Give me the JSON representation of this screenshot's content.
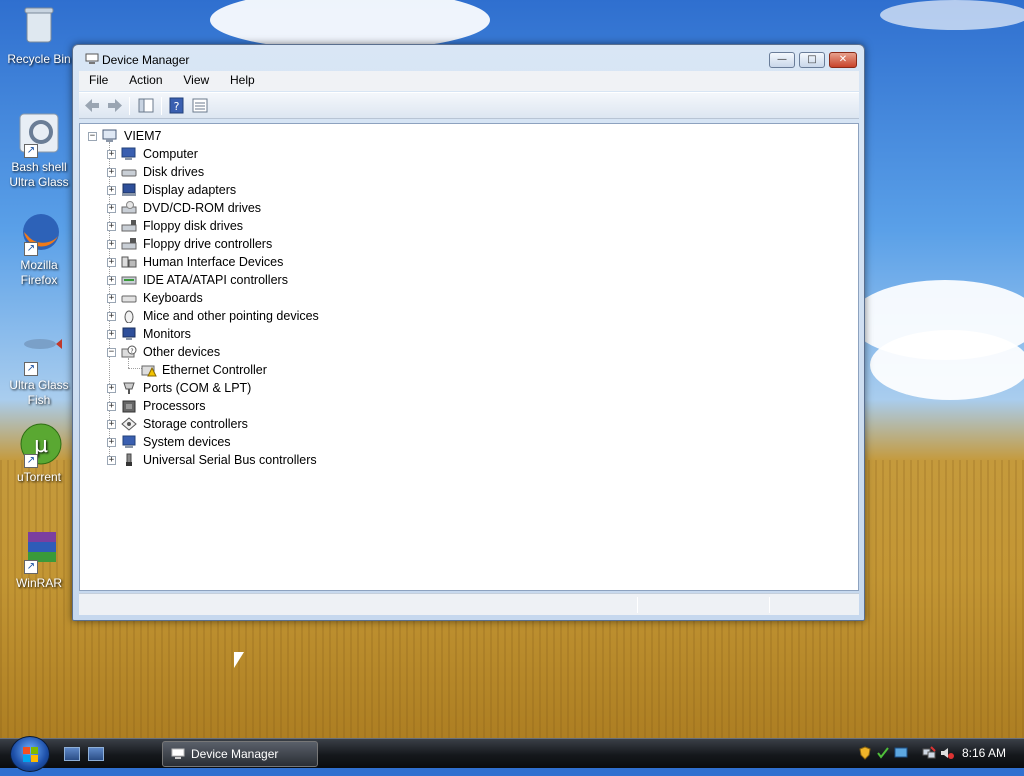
{
  "desktop": {
    "icons": [
      {
        "name": "recycle-bin",
        "label": "Recycle Bin"
      },
      {
        "name": "bash-shell",
        "label": "Bash shell Ultra Glass"
      },
      {
        "name": "mozilla-firefox",
        "label": "Mozilla Firefox"
      },
      {
        "name": "ultra-glass-fish",
        "label": "Ultra Glass Fish"
      },
      {
        "name": "utorrent",
        "label": "uTorrent"
      },
      {
        "name": "winrar",
        "label": "WinRAR"
      }
    ]
  },
  "window": {
    "title": "Device Manager",
    "controls": {
      "minimize": "—",
      "maximize": "□",
      "close": "✕"
    },
    "menu": [
      "File",
      "Action",
      "View",
      "Help"
    ],
    "toolbar": [
      "back-icon",
      "forward-icon",
      "show-hide-console-tree-icon",
      "help-icon",
      "properties-icon"
    ],
    "tree": {
      "root": "VIEM7",
      "categories": [
        {
          "label": "Computer",
          "icon": "computer-icon",
          "expanded": false
        },
        {
          "label": "Disk drives",
          "icon": "disk-drive-icon",
          "expanded": false
        },
        {
          "label": "Display adapters",
          "icon": "display-adapter-icon",
          "expanded": false
        },
        {
          "label": "DVD/CD-ROM drives",
          "icon": "dvd-drive-icon",
          "expanded": false
        },
        {
          "label": "Floppy disk drives",
          "icon": "floppy-disk-icon",
          "expanded": false
        },
        {
          "label": "Floppy drive controllers",
          "icon": "floppy-controller-icon",
          "expanded": false
        },
        {
          "label": "Human Interface Devices",
          "icon": "hid-icon",
          "expanded": false
        },
        {
          "label": "IDE ATA/ATAPI controllers",
          "icon": "ide-controller-icon",
          "expanded": false
        },
        {
          "label": "Keyboards",
          "icon": "keyboard-icon",
          "expanded": false
        },
        {
          "label": "Mice and other pointing devices",
          "icon": "mouse-icon",
          "expanded": false
        },
        {
          "label": "Monitors",
          "icon": "monitor-icon",
          "expanded": false
        },
        {
          "label": "Other devices",
          "icon": "other-devices-icon",
          "expanded": true,
          "children": [
            {
              "label": "Ethernet Controller",
              "icon": "warning-device-icon"
            }
          ]
        },
        {
          "label": "Ports (COM & LPT)",
          "icon": "port-icon",
          "expanded": false
        },
        {
          "label": "Processors",
          "icon": "processor-icon",
          "expanded": false
        },
        {
          "label": "Storage controllers",
          "icon": "storage-controller-icon",
          "expanded": false
        },
        {
          "label": "System devices",
          "icon": "system-devices-icon",
          "expanded": false
        },
        {
          "label": "Universal Serial Bus controllers",
          "icon": "usb-icon",
          "expanded": false
        }
      ]
    }
  },
  "taskbar": {
    "active_window": "Device Manager",
    "quick_launch": [
      "show-desktop-icon",
      "switch-windows-icon"
    ],
    "tray_icons": [
      "security-shield-icon",
      "network-icon",
      "speaker-muted-icon"
    ],
    "clock": "8:16 AM"
  },
  "colors": {
    "window_frame": "#c6d8ee",
    "taskbar": "#15181c",
    "tree_bg": "#ffffff"
  }
}
